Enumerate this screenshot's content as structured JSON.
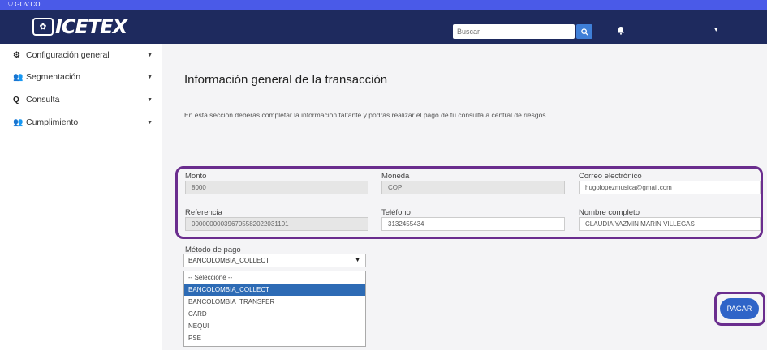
{
  "gov_bar": {
    "label": "GOV.CO"
  },
  "header": {
    "logo_text": "ICETEX",
    "search": {
      "placeholder": "Buscar"
    }
  },
  "sidebar": {
    "items": [
      {
        "label": "Configuración general",
        "icon": "gears-icon"
      },
      {
        "label": "Segmentación",
        "icon": "users-icon"
      },
      {
        "label": "Consulta",
        "icon": "search-icon"
      },
      {
        "label": "Cumplimiento",
        "icon": "users-icon"
      }
    ]
  },
  "main": {
    "title": "Información general de la transacción",
    "description": "En esta sección deberás completar la información faltante y podrás realizar el pago de tu consulta a central de riesgos.",
    "fields": {
      "monto": {
        "label": "Monto",
        "value": "8000"
      },
      "moneda": {
        "label": "Moneda",
        "value": "COP"
      },
      "correo": {
        "label": "Correo electrónico",
        "value": "hugolopezmusica@gmail.com"
      },
      "referencia": {
        "label": "Referencia",
        "value": "000000000396705582022031101"
      },
      "telefono": {
        "label": "Teléfono",
        "value": "3132455434"
      },
      "nombre": {
        "label": "Nombre completo",
        "value": "CLAUDIA YAZMIN MARIN VILLEGAS"
      }
    },
    "payment_method": {
      "label": "Método de pago",
      "selected": "BANCOLOMBIA_COLLECT",
      "options": [
        "-- Seleccione --",
        "BANCOLOMBIA_COLLECT",
        "BANCOLOMBIA_TRANSFER",
        "CARD",
        "NEQUI",
        "PSE"
      ]
    },
    "pay_button": "PAGAR"
  },
  "colors": {
    "gov_bar": "#4a5ae8",
    "header": "#1e2a5e",
    "highlight": "#6a2d8e",
    "button": "#2f64c8",
    "selected_option": "#2d6bb5"
  }
}
